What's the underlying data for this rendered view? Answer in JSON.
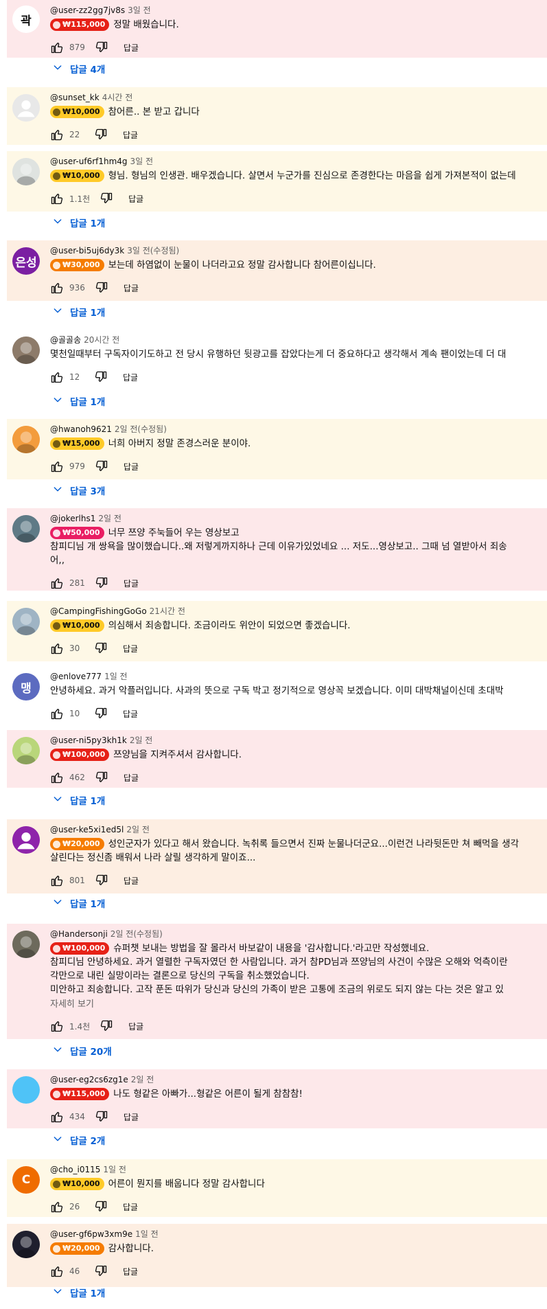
{
  "reply_label": "답글",
  "more_label": "자세히 보기",
  "comments": [
    {
      "author": "@user-zz2gg7jv8s",
      "time": "3일 전",
      "amount": "₩115,000",
      "text": [
        "정말 배웠습니다."
      ],
      "likes": "879",
      "replies": "답글 4개",
      "avatar": {
        "type": "text",
        "text": "곽",
        "color": "#ffffff",
        "fg": "#0f0f0f"
      }
    },
    {
      "author": "@sunset_kk",
      "time": "4시간 전",
      "amount": "₩10,000",
      "text": [
        "참어른.. 본 받고 갑니다"
      ],
      "likes": "22",
      "replies": "",
      "avatar": {
        "type": "person",
        "color": "#e8e8e8"
      }
    },
    {
      "author": "@user-uf6rf1hm4g",
      "time": "3일 전",
      "amount": "₩10,000",
      "text": [
        "형님. 형님의 인생관. 배우겠습니다. 살면서 누군가를 진심으로 존경한다는 마음을 쉽게 가져본적이 없는데"
      ],
      "likes": "1.1천",
      "replies": "답글 1개",
      "avatar": {
        "type": "photo",
        "color": "#dfe3e0"
      }
    },
    {
      "author": "@user-bi5uj6dy3k",
      "time": "3일 전(수정됨)",
      "amount": "₩30,000",
      "text": [
        "보는데 하염없이 눈물이 나더라고요 정말 감사합니다 참어른이십니다."
      ],
      "likes": "936",
      "replies": "답글 1개",
      "avatar": {
        "type": "text",
        "text": "은성",
        "color": "#7b1fa2",
        "fg": "#ffffff"
      }
    },
    {
      "author": "@골골송",
      "time": "20시간 전",
      "amount": "",
      "text": [
        "몇천일때부터 구독자이기도하고 전 당시 유행하던 뒷광고를 잡았다는게 더 중요하다고 생각해서 계속 팬이었는데 더 대"
      ],
      "likes": "12",
      "replies": "답글 1개",
      "avatar": {
        "type": "photo",
        "color": "#8d7b6a"
      }
    },
    {
      "author": "@hwanoh9621",
      "time": "2일 전(수정됨)",
      "amount": "₩15,000",
      "text": [
        "너희 아버지 정말 존경스러운 분이야."
      ],
      "likes": "979",
      "replies": "답글 3개",
      "avatar": {
        "type": "photo",
        "color": "#f39c3d"
      }
    },
    {
      "author": "@jokerlhs1",
      "time": "2일 전",
      "amount": "₩50,000",
      "text": [
        "너무 쯔양 주눅들어 우는 영상보고",
        "참피디님 개 쌍욕을 많이했습니다..왜 저렇게까지하나 근데 이유가있었네요 ... 저도...영상보고.. 그때  넘 열받아서 죄송",
        "어,,"
      ],
      "likes": "281",
      "replies": "",
      "avatar": {
        "type": "photo",
        "color": "#5f7a86"
      }
    },
    {
      "author": "@CampingFishingGoGo",
      "time": "21시간 전",
      "amount": "₩10,000",
      "text": [
        "의심해서 죄송합니다. 조금이라도 위안이 되었으면 좋겠습니다."
      ],
      "likes": "30",
      "replies": "",
      "avatar": {
        "type": "photo",
        "color": "#9fb4c4"
      }
    },
    {
      "author": "@enlove777",
      "time": "1일 전",
      "amount": "",
      "text": [
        "안녕하세요. 과거 악플러입니다. 사과의 뜻으로 구독 박고 정기적으로 영상꼭 보겠습니다. 이미 대박채널이신데 초대박"
      ],
      "likes": "10",
      "replies": "",
      "avatar": {
        "type": "text",
        "text": "맹",
        "color": "#5c6bc0",
        "fg": "#ffffff"
      }
    },
    {
      "author": "@user-ni5py3kh1k",
      "time": "2일 전",
      "amount": "₩100,000",
      "text": [
        "쯔양님을 지켜주셔서 감사합니다."
      ],
      "likes": "462",
      "replies": "답글 1개",
      "avatar": {
        "type": "photo",
        "color": "#b9d67a"
      }
    },
    {
      "author": "@user-ke5xi1ed5l",
      "time": "2일 전",
      "amount": "₩20,000",
      "text": [
        "성인군자가 있다고 해서 왔습니다. 녹취록 들으면서 진짜 눈물나더군요...이런건 나라뒷돈만 쳐 빼먹을 생각",
        "살린다는 정신좀 배워서 나라 살릴 생각하게 말이죠..."
      ],
      "likes": "801",
      "replies": "답글 1개",
      "avatar": {
        "type": "person",
        "color": "#8e24aa"
      }
    },
    {
      "author": "@Handersonji",
      "time": "2일 전(수정됨)",
      "amount": "₩100,000",
      "text": [
        "슈퍼챗 보내는 방법을 잘 몰라서 바보같이 내용을 '감사합니다.'라고만 작성했네요.",
        "참피디님 안녕하세요. 과거 열렬한 구독자였던 한 사람입니다. 과거 참PD님과 쯔양님의 사건이 수많은 오해와 억측이란",
        "각만으로 내린 실망이라는 결론으로 당신의 구독을 취소했었습니다.",
        "미안하고 죄송합니다. 고작 푼돈 따위가 당신과 당신의 가족이 받은 고통에 조금의 위로도 되지 않는 다는 것은 알고 있"
      ],
      "likes": "1.4천",
      "replies": "답글 20개",
      "more": true,
      "avatar": {
        "type": "photo",
        "color": "#6d6a5c"
      }
    },
    {
      "author": "@user-eg2cs6zg1e",
      "time": "2일 전",
      "amount": "₩115,000",
      "text": [
        "나도 형같은 아빠가...형같은 어른이 될게 참참참!"
      ],
      "likes": "434",
      "replies": "답글 2개",
      "avatar": {
        "type": "plain",
        "color": "#4fc3f7"
      }
    },
    {
      "author": "@cho_i0115",
      "time": "1일 전",
      "amount": "₩10,000",
      "text": [
        "어른이 뭔지를 배웁니다 정말 감사합니다"
      ],
      "likes": "26",
      "replies": "",
      "avatar": {
        "type": "text",
        "text": "C",
        "color": "#ef6c00",
        "fg": "#ffffff"
      }
    },
    {
      "author": "@user-gf6pw3xm9e",
      "time": "1일 전",
      "amount": "₩20,000",
      "text": [
        "감사합니다."
      ],
      "likes": "46",
      "replies": "답글 1개",
      "avatar": {
        "type": "photo",
        "color": "#1f1f2e"
      }
    }
  ]
}
